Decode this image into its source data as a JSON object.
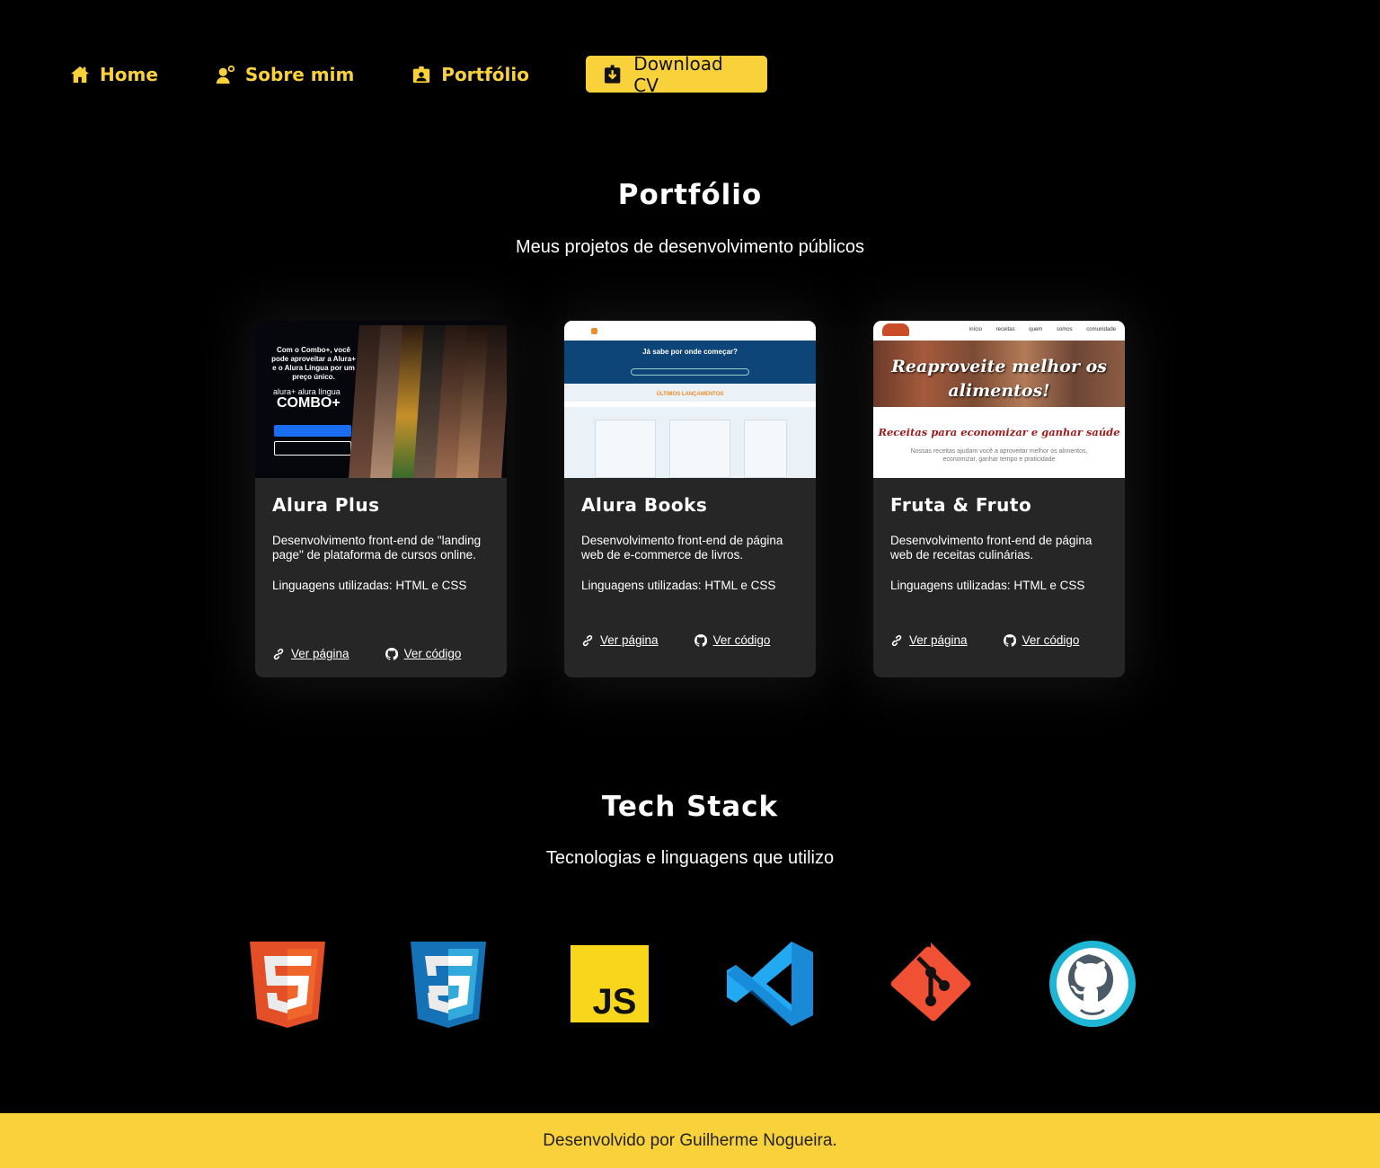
{
  "nav": {
    "home": "Home",
    "about": "Sobre mim",
    "portfolio": "Portfólio",
    "download": "Download CV"
  },
  "portfolio": {
    "title": "Portfólio",
    "subtitle": "Meus projetos de desenvolvimento públicos",
    "cards": [
      {
        "title": "Alura Plus",
        "description": "Desenvolvimento front-end de \"landing page\" de plataforma de cursos online.",
        "languages": "Linguagens utilizadas: HTML e CSS",
        "view_page": "Ver página",
        "view_code": "Ver código",
        "thumb": {
          "text": "Com o Combo+, você pode aproveitar a Alura+ e o Alura Língua por um preço único.",
          "brand": "alura+ alura língua",
          "combo": "COMBO+"
        }
      },
      {
        "title": "Alura Books",
        "description": "Desenvolvimento front-end de página web de e-commerce de livros.",
        "languages": "Linguagens utilizadas: HTML e CSS",
        "view_page": "Ver página",
        "view_code": "Ver código",
        "thumb": {
          "hero": "Já sabe por onde começar?",
          "band": "ÚLTIMOS LANÇAMENTOS"
        }
      },
      {
        "title": "Fruta & Fruto",
        "description": "Desenvolvimento front-end de página web de receitas culinárias.",
        "languages": "Linguagens utilizadas: HTML e CSS",
        "view_page": "Ver página",
        "view_code": "Ver código",
        "thumb": {
          "menu": "início receitas quem somos comunidade",
          "headline": "Reaproveite melhor os alimentos!",
          "sub": "Receitas para economizar e ganhar saúde",
          "small": "Nossas receitas ajudam você a aproveitar melhor os alimentos, economizar, ganhar tempo e praticidade"
        }
      }
    ]
  },
  "tech": {
    "title": "Tech Stack",
    "subtitle": "Tecnologias e linguagens que utilizo",
    "icons": [
      "html5-icon",
      "css3-icon",
      "javascript-icon",
      "vscode-icon",
      "git-icon",
      "github-icon"
    ],
    "colors": {
      "html5": "#e34f26",
      "css3": "#1572b6",
      "js": "#f7df1e",
      "vscode": "#23a9f2",
      "git": "#f05033",
      "github": "#1fb6d6"
    }
  },
  "footer": {
    "text": "Desenvolvido por Guilherme Nogueira."
  },
  "accent": "#f9d23b"
}
